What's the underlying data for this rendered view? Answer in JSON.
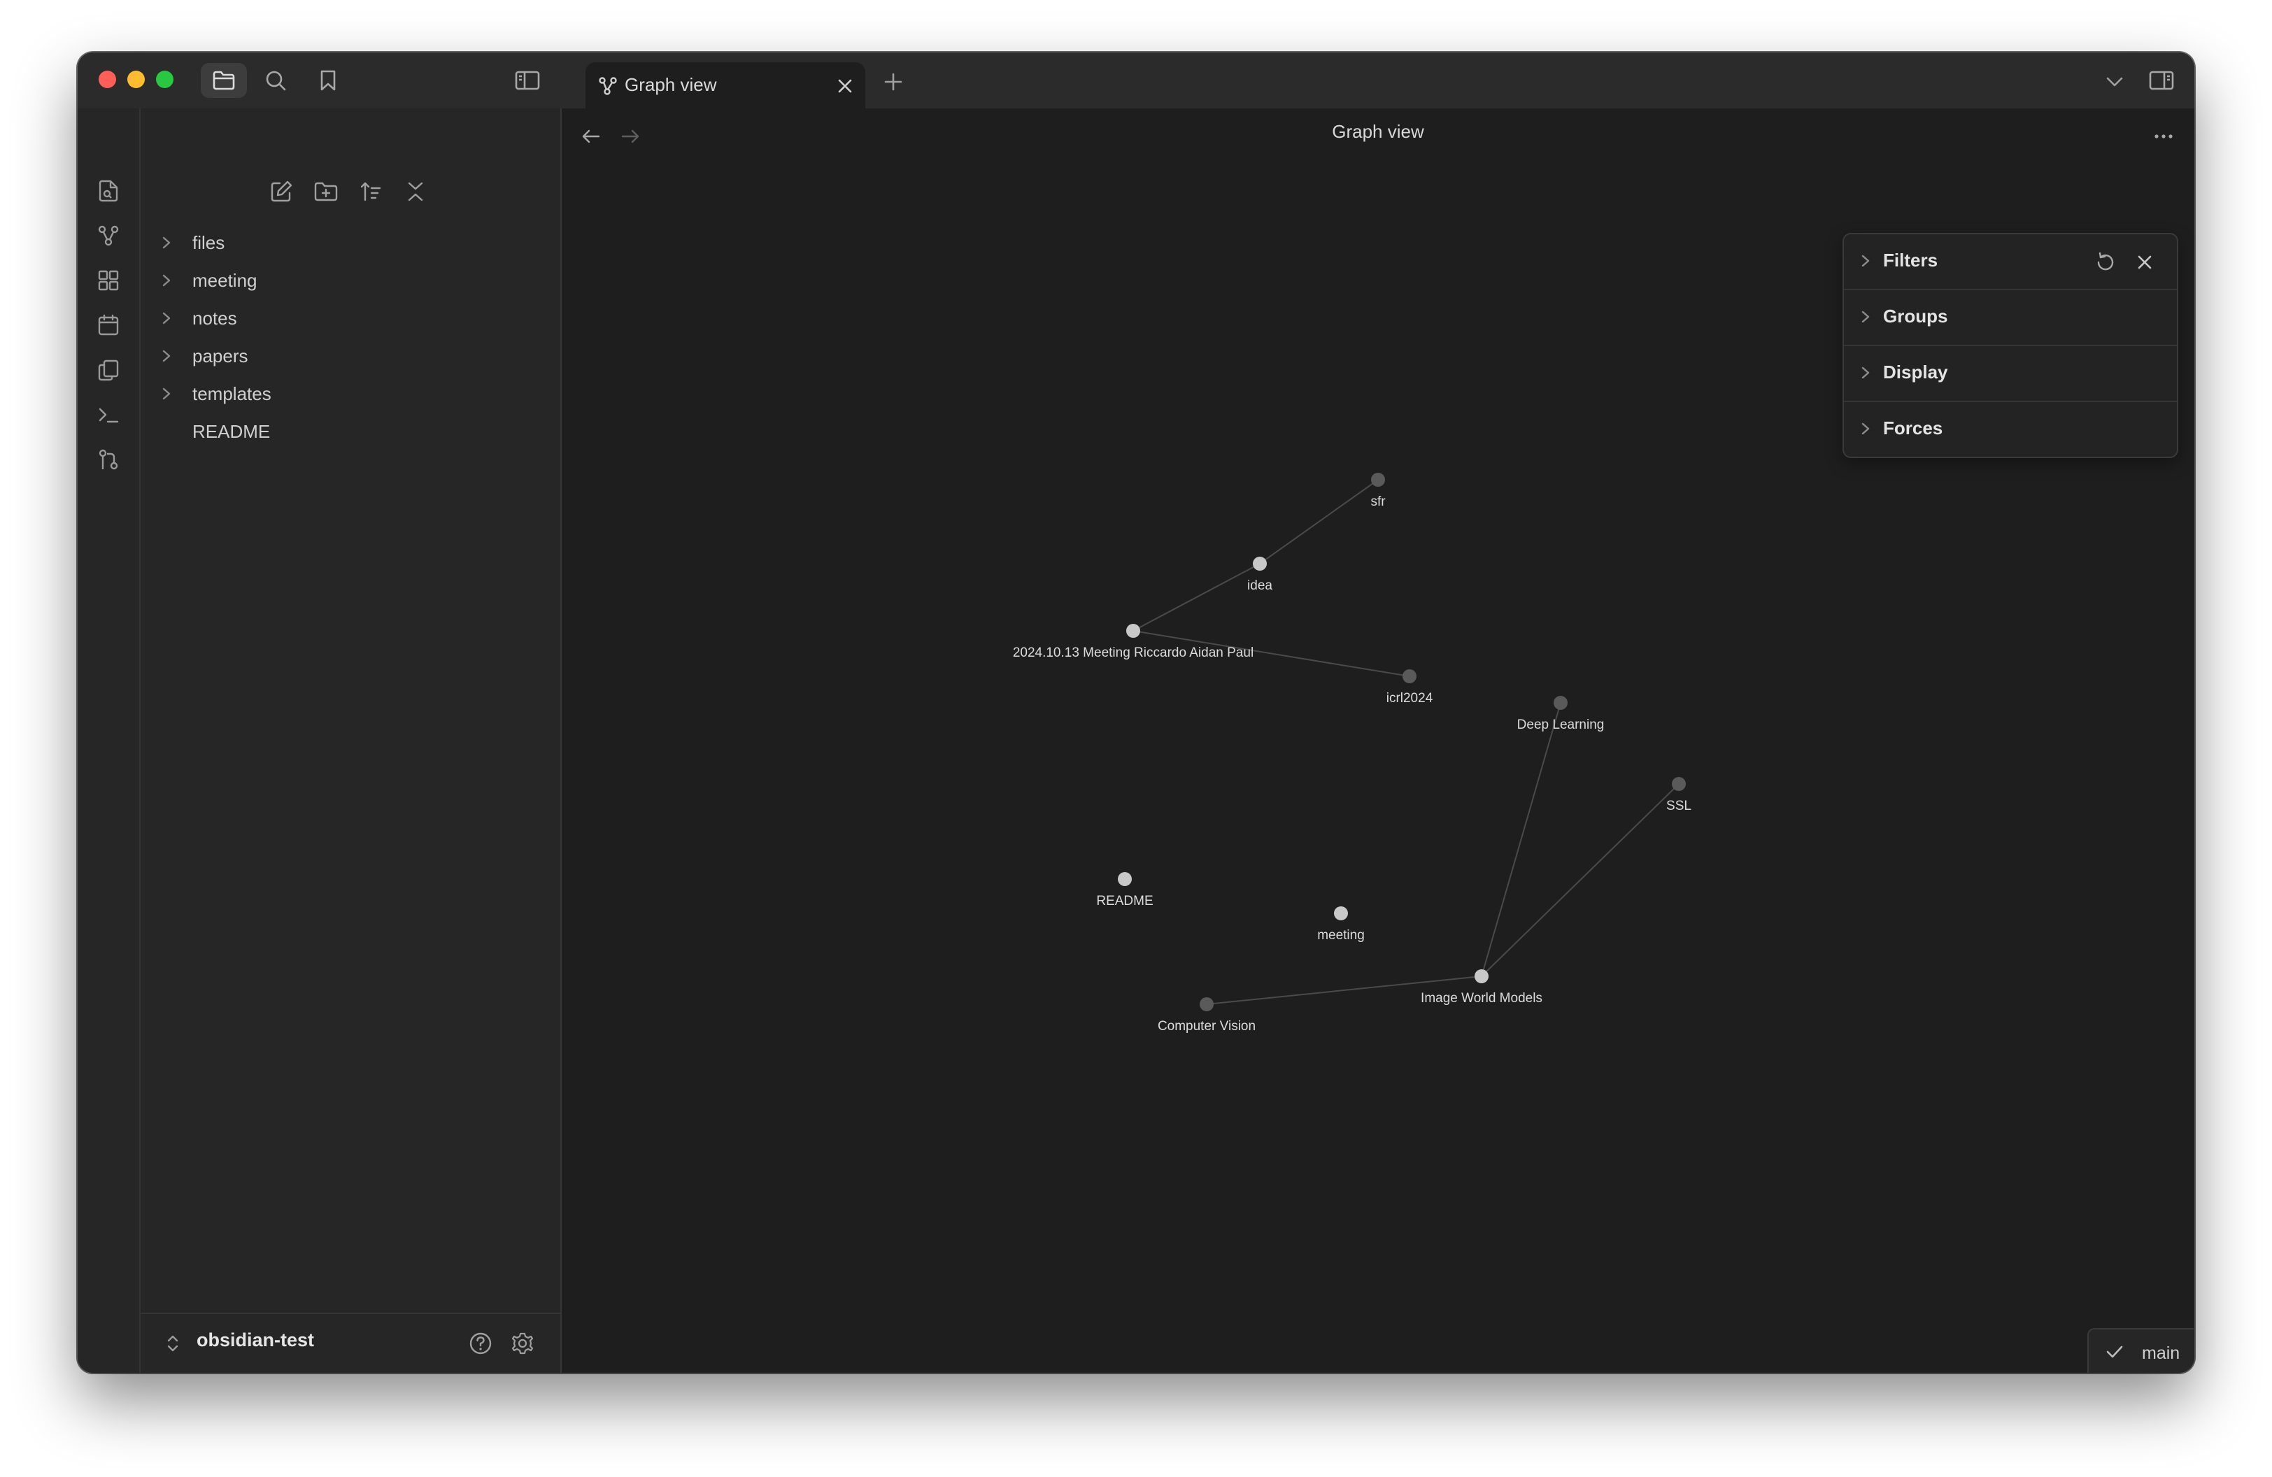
{
  "tab": {
    "title": "Graph view",
    "new_tab_symbol": "+"
  },
  "header": {
    "title": "Graph view"
  },
  "sidebar": {
    "items": [
      {
        "label": "files",
        "folder": true
      },
      {
        "label": "meeting",
        "folder": true
      },
      {
        "label": "notes",
        "folder": true
      },
      {
        "label": "papers",
        "folder": true
      },
      {
        "label": "templates",
        "folder": true
      },
      {
        "label": "README",
        "folder": false
      }
    ]
  },
  "vault": {
    "name": "obsidian-test"
  },
  "graph": {
    "nodes": [
      {
        "label": "sfr"
      },
      {
        "label": "idea"
      },
      {
        "label": "2024.10.13 Meeting Riccardo Aidan Paul"
      },
      {
        "label": "icrl2024"
      },
      {
        "label": "Deep Learning"
      },
      {
        "label": "SSL"
      },
      {
        "label": "README"
      },
      {
        "label": "meeting"
      },
      {
        "label": "Image World Models"
      },
      {
        "label": "Computer Vision"
      }
    ]
  },
  "graph_settings": {
    "sections": [
      {
        "label": "Filters"
      },
      {
        "label": "Groups"
      },
      {
        "label": "Display"
      },
      {
        "label": "Forces"
      }
    ]
  },
  "status": {
    "branch": "main"
  },
  "colors": {
    "background": "#1e1e1e",
    "sidebar": "#262626",
    "titlebar": "#2b2b2b",
    "node_resolved": "#c8c8c8",
    "node_unresolved": "#5a5a5a",
    "edge": "#4a4a4a"
  }
}
